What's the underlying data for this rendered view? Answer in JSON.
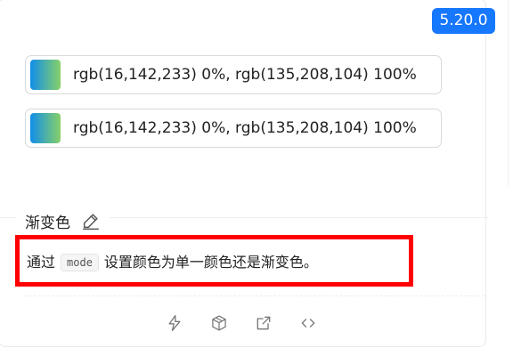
{
  "version_badge": "5.20.0",
  "color_pickers": [
    {
      "value_text": "rgb(16,142,233) 0%, rgb(135,208,104) 100%"
    },
    {
      "value_text": "rgb(16,142,233) 0%, rgb(135,208,104) 100%"
    }
  ],
  "section": {
    "title": "渐变色",
    "description_before": "通过",
    "description_code": "mode",
    "description_after": "设置颜色为单一颜色还是渐变色。"
  },
  "actions": [
    {
      "icon": "lightning-icon"
    },
    {
      "icon": "codesandbox-icon"
    },
    {
      "icon": "open-external-icon"
    },
    {
      "icon": "code-icon"
    }
  ],
  "colors": {
    "badge": "#1677ff",
    "highlight_border": "#ff0000",
    "gradient_start": "rgb(16,142,233)",
    "gradient_end": "rgb(135,208,104)"
  }
}
